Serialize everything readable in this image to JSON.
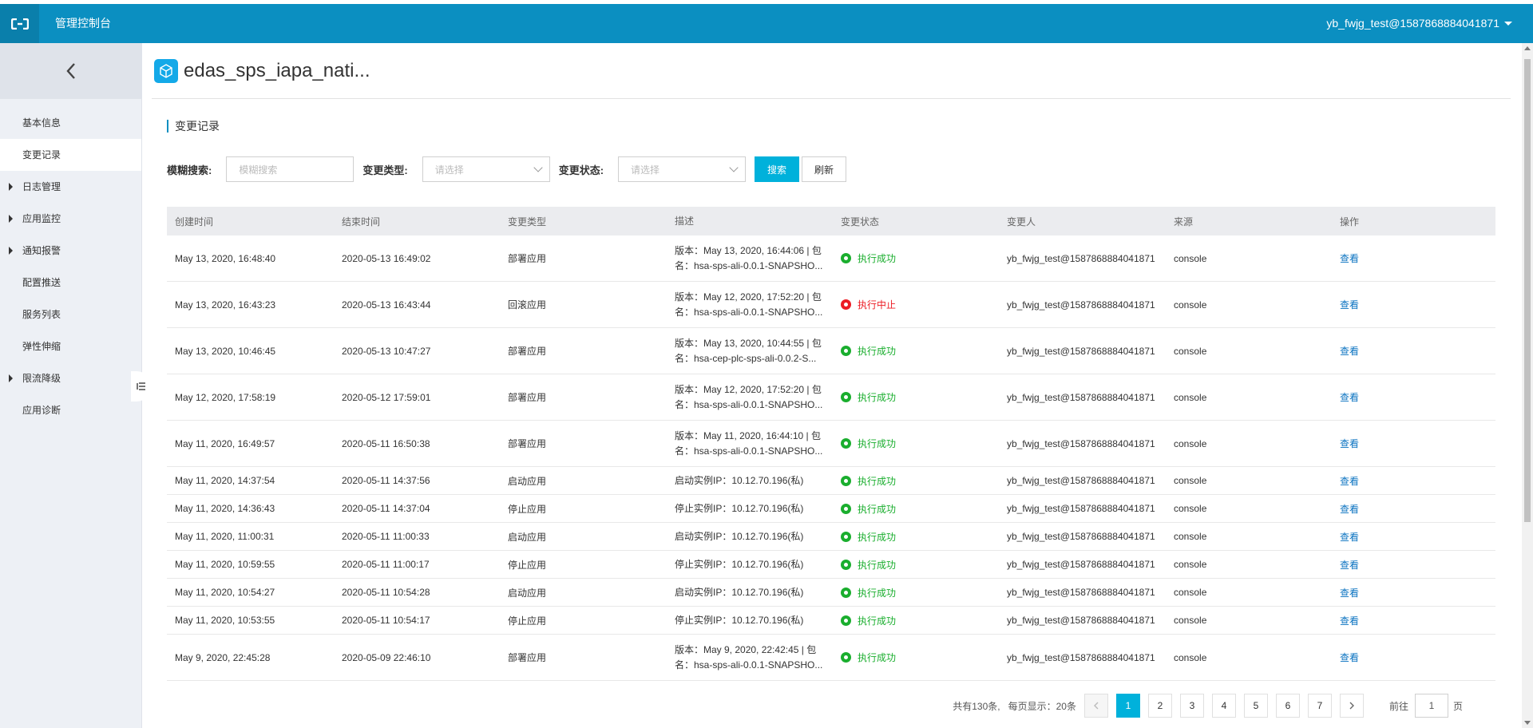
{
  "topbar": {
    "title": "管理控制台",
    "user": "yb_fwjg_test@1587868884041871",
    "logo_icon": "aliyun-logo-icon",
    "bg_color": "#0b8fc1"
  },
  "sidebar": {
    "back_icon": "chevron-left-icon",
    "items": [
      {
        "label": "基本信息",
        "expandable": false,
        "active": false
      },
      {
        "label": "变更记录",
        "expandable": false,
        "active": true
      },
      {
        "label": "日志管理",
        "expandable": true,
        "active": false
      },
      {
        "label": "应用监控",
        "expandable": true,
        "active": false
      },
      {
        "label": "通知报警",
        "expandable": true,
        "active": false
      },
      {
        "label": "配置推送",
        "expandable": false,
        "active": false
      },
      {
        "label": "服务列表",
        "expandable": false,
        "active": false
      },
      {
        "label": "弹性伸缩",
        "expandable": false,
        "active": false
      },
      {
        "label": "限流降级",
        "expandable": true,
        "active": false
      },
      {
        "label": "应用诊断",
        "expandable": false,
        "active": false
      }
    ]
  },
  "app": {
    "name": "edas_sps_iapa_nati...",
    "icon": "cube-icon"
  },
  "section": {
    "title": "变更记录"
  },
  "filters": {
    "fuzzy_label": "模糊搜索:",
    "fuzzy_placeholder": "模糊搜索",
    "type_label": "变更类型:",
    "type_placeholder": "请选择",
    "status_label": "变更状态:",
    "status_placeholder": "请选择",
    "search_button": "搜索",
    "refresh_button": "刷新"
  },
  "table": {
    "headers": [
      "创建时间",
      "结束时间",
      "变更类型",
      "描述",
      "变更状态",
      "变更人",
      "来源",
      "操作"
    ],
    "rows": [
      {
        "created": "May 13, 2020, 16:48:40",
        "ended": "2020-05-13 16:49:02",
        "type": "部署应用",
        "desc1": "版本：May 13, 2020, 16:44:06 | 包",
        "desc2": "名：hsa-sps-ali-0.0.1-SNAPSHO...",
        "status": "执行成功",
        "state": "success",
        "user": "yb_fwjg_test@1587868884041871",
        "source": "console",
        "action": "查看"
      },
      {
        "created": "May 13, 2020, 16:43:23",
        "ended": "2020-05-13 16:43:44",
        "type": "回滚应用",
        "desc1": "版本：May 12, 2020, 17:52:20 | 包",
        "desc2": "名：hsa-sps-ali-0.0.1-SNAPSHO...",
        "status": "执行中止",
        "state": "stop",
        "user": "yb_fwjg_test@1587868884041871",
        "source": "console",
        "action": "查看"
      },
      {
        "created": "May 13, 2020, 10:46:45",
        "ended": "2020-05-13 10:47:27",
        "type": "部署应用",
        "desc1": "版本：May 13, 2020, 10:44:55 | 包",
        "desc2": "名：hsa-cep-plc-sps-ali-0.0.2-S...",
        "status": "执行成功",
        "state": "success",
        "user": "yb_fwjg_test@1587868884041871",
        "source": "console",
        "action": "查看"
      },
      {
        "created": "May 12, 2020, 17:58:19",
        "ended": "2020-05-12 17:59:01",
        "type": "部署应用",
        "desc1": "版本：May 12, 2020, 17:52:20 | 包",
        "desc2": "名：hsa-sps-ali-0.0.1-SNAPSHO...",
        "status": "执行成功",
        "state": "success",
        "user": "yb_fwjg_test@1587868884041871",
        "source": "console",
        "action": "查看"
      },
      {
        "created": "May 11, 2020, 16:49:57",
        "ended": "2020-05-11 16:50:38",
        "type": "部署应用",
        "desc1": "版本：May 11, 2020, 16:44:10 | 包",
        "desc2": "名：hsa-sps-ali-0.0.1-SNAPSHO...",
        "status": "执行成功",
        "state": "success",
        "user": "yb_fwjg_test@1587868884041871",
        "source": "console",
        "action": "查看"
      },
      {
        "created": "May 11, 2020, 14:37:54",
        "ended": "2020-05-11 14:37:56",
        "type": "启动应用",
        "desc1": "启动实例IP：10.12.70.196(私)",
        "desc2": "",
        "status": "执行成功",
        "state": "success",
        "user": "yb_fwjg_test@1587868884041871",
        "source": "console",
        "action": "查看"
      },
      {
        "created": "May 11, 2020, 14:36:43",
        "ended": "2020-05-11 14:37:04",
        "type": "停止应用",
        "desc1": "停止实例IP：10.12.70.196(私)",
        "desc2": "",
        "status": "执行成功",
        "state": "success",
        "user": "yb_fwjg_test@1587868884041871",
        "source": "console",
        "action": "查看"
      },
      {
        "created": "May 11, 2020, 11:00:31",
        "ended": "2020-05-11 11:00:33",
        "type": "启动应用",
        "desc1": "启动实例IP：10.12.70.196(私)",
        "desc2": "",
        "status": "执行成功",
        "state": "success",
        "user": "yb_fwjg_test@1587868884041871",
        "source": "console",
        "action": "查看"
      },
      {
        "created": "May 11, 2020, 10:59:55",
        "ended": "2020-05-11 11:00:17",
        "type": "停止应用",
        "desc1": "停止实例IP：10.12.70.196(私)",
        "desc2": "",
        "status": "执行成功",
        "state": "success",
        "user": "yb_fwjg_test@1587868884041871",
        "source": "console",
        "action": "查看"
      },
      {
        "created": "May 11, 2020, 10:54:27",
        "ended": "2020-05-11 10:54:28",
        "type": "启动应用",
        "desc1": "启动实例IP：10.12.70.196(私)",
        "desc2": "",
        "status": "执行成功",
        "state": "success",
        "user": "yb_fwjg_test@1587868884041871",
        "source": "console",
        "action": "查看"
      },
      {
        "created": "May 11, 2020, 10:53:55",
        "ended": "2020-05-11 10:54:17",
        "type": "停止应用",
        "desc1": "停止实例IP：10.12.70.196(私)",
        "desc2": "",
        "status": "执行成功",
        "state": "success",
        "user": "yb_fwjg_test@1587868884041871",
        "source": "console",
        "action": "查看"
      },
      {
        "created": "May 9, 2020, 22:45:28",
        "ended": "2020-05-09 22:46:10",
        "type": "部署应用",
        "desc1": "版本：May 9, 2020, 22:42:45 | 包",
        "desc2": "名：hsa-sps-ali-0.0.1-SNAPSHO...",
        "status": "执行成功",
        "state": "success",
        "user": "yb_fwjg_test@1587868884041871",
        "source": "console",
        "action": "查看"
      }
    ]
  },
  "pagination": {
    "total_text": "共有130条,",
    "per_page_text": "每页显示：20条",
    "prev_icon": "chevron-left-icon",
    "next_icon": "chevron-right-icon",
    "pages": [
      "1",
      "2",
      "3",
      "4",
      "5",
      "6",
      "7"
    ],
    "current_page": "1",
    "goto_label": "前往",
    "goto_value": "1",
    "goto_suffix": "页"
  },
  "colors": {
    "accent": "#00b1db",
    "success": "#1aae2e",
    "stop": "#ec1c24",
    "link": "#0b73c1"
  }
}
